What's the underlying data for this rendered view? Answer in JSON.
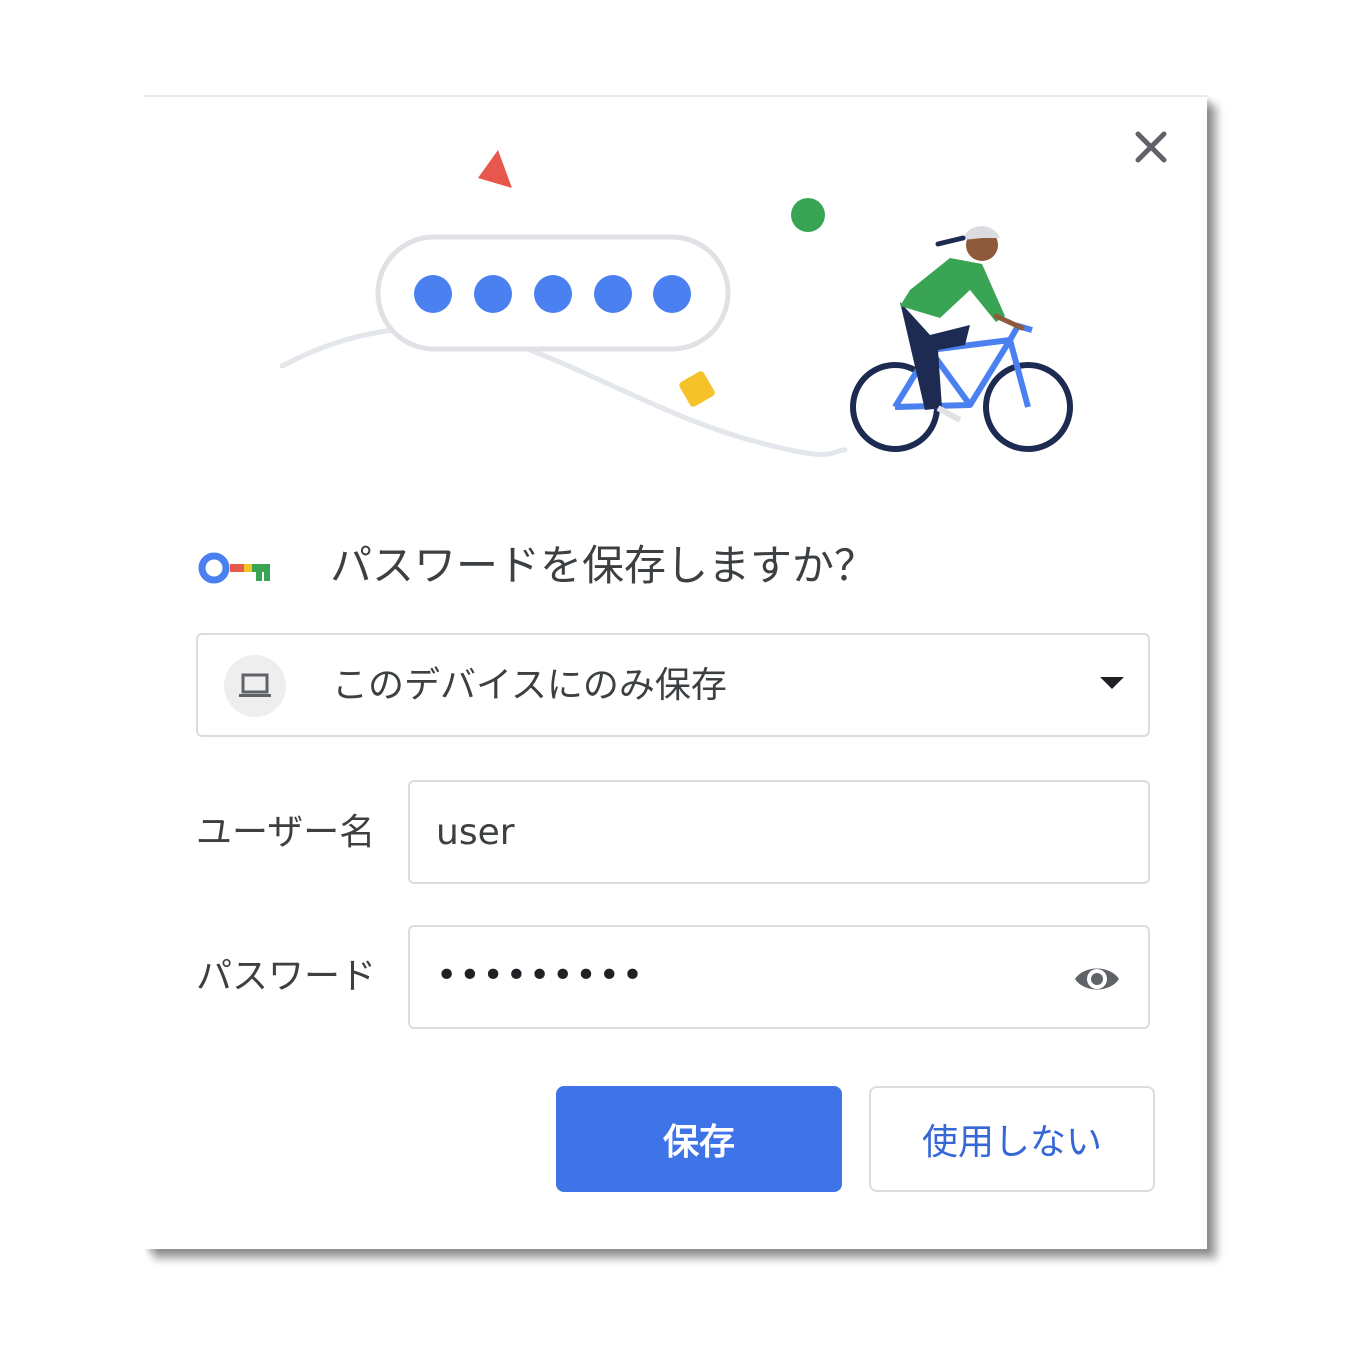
{
  "dialog": {
    "title": "パスワードを保存しますか？",
    "close_icon": "close-icon",
    "key_icon": "key-icon"
  },
  "storage_select": {
    "icon": "laptop-icon",
    "selected": "このデバイスにのみ保存"
  },
  "username": {
    "label": "ユーザー名",
    "value": "user"
  },
  "password": {
    "label": "パスワード",
    "masked_value": "•••••••••",
    "toggle_icon": "eye-icon"
  },
  "buttons": {
    "save": "保存",
    "never": "使用しない"
  },
  "colors": {
    "primary": "#3f73e8",
    "secondary_text": "#3567d6",
    "google_blue": "#4a80f0",
    "google_red": "#e8574b",
    "google_yellow": "#f6c22a",
    "google_green": "#3aa455"
  }
}
